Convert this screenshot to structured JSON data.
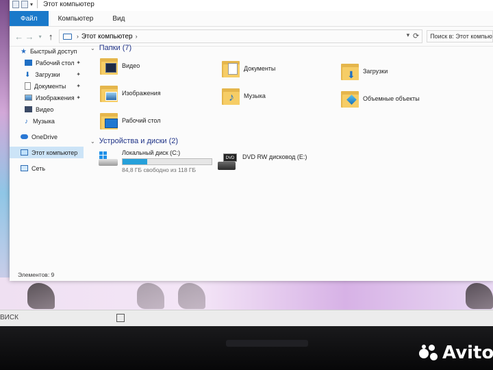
{
  "window": {
    "title": "Этот компьютер"
  },
  "ribbon": {
    "tabs": [
      "Файл",
      "Компьютер",
      "Вид"
    ]
  },
  "address": {
    "path": "Этот компьютер",
    "search_placeholder": "Поиск в: Этот компьютер"
  },
  "sidebar": {
    "items": [
      {
        "label": "Быстрый доступ",
        "icon": "star-icon",
        "pinned": false
      },
      {
        "label": "Рабочий стол",
        "icon": "desktop-icon",
        "pinned": true
      },
      {
        "label": "Загрузки",
        "icon": "download-icon",
        "pinned": true
      },
      {
        "label": "Документы",
        "icon": "document-icon",
        "pinned": true
      },
      {
        "label": "Изображения",
        "icon": "image-icon",
        "pinned": true
      },
      {
        "label": "Видео",
        "icon": "video-icon",
        "pinned": false
      },
      {
        "label": "Музыка",
        "icon": "music-icon",
        "pinned": false
      },
      {
        "label": "OneDrive",
        "icon": "cloud-icon",
        "pinned": false
      },
      {
        "label": "Этот компьютер",
        "icon": "computer-icon",
        "pinned": false,
        "selected": true
      },
      {
        "label": "Сеть",
        "icon": "network-icon",
        "pinned": false
      }
    ],
    "pin_glyph": "📌"
  },
  "folders": {
    "header": "Папки (7)",
    "items": [
      {
        "label": "Видео",
        "icon": "video-folder-icon"
      },
      {
        "label": "Документы",
        "icon": "documents-folder-icon"
      },
      {
        "label": "Загрузки",
        "icon": "downloads-folder-icon"
      },
      {
        "label": "Изображения",
        "icon": "pictures-folder-icon"
      },
      {
        "label": "Музыка",
        "icon": "music-folder-icon"
      },
      {
        "label": "Объемные объекты",
        "icon": "3d-objects-folder-icon"
      },
      {
        "label": "Рабочий стол",
        "icon": "desktop-folder-icon"
      }
    ]
  },
  "devices": {
    "header": "Устройства и диски (2)",
    "items": [
      {
        "label": "Локальный диск (C:)",
        "free_text": "84,8 ГБ свободно из 118 ГБ",
        "used_fraction": 0.28,
        "icon": "windows-drive-icon"
      },
      {
        "label": "DVD RW дисковод (E:)",
        "icon": "dvd-drive-icon",
        "badge": "DVD"
      }
    ]
  },
  "status": {
    "text": "Элементов: 9"
  },
  "taskbar": {
    "search_text": "ВИСК"
  },
  "watermark": {
    "brand": "Avito"
  },
  "colors": {
    "accent": "#1979ca",
    "folder": "#f6cd66",
    "selection": "#cce4f7",
    "drive_bar": "#26a0da"
  }
}
